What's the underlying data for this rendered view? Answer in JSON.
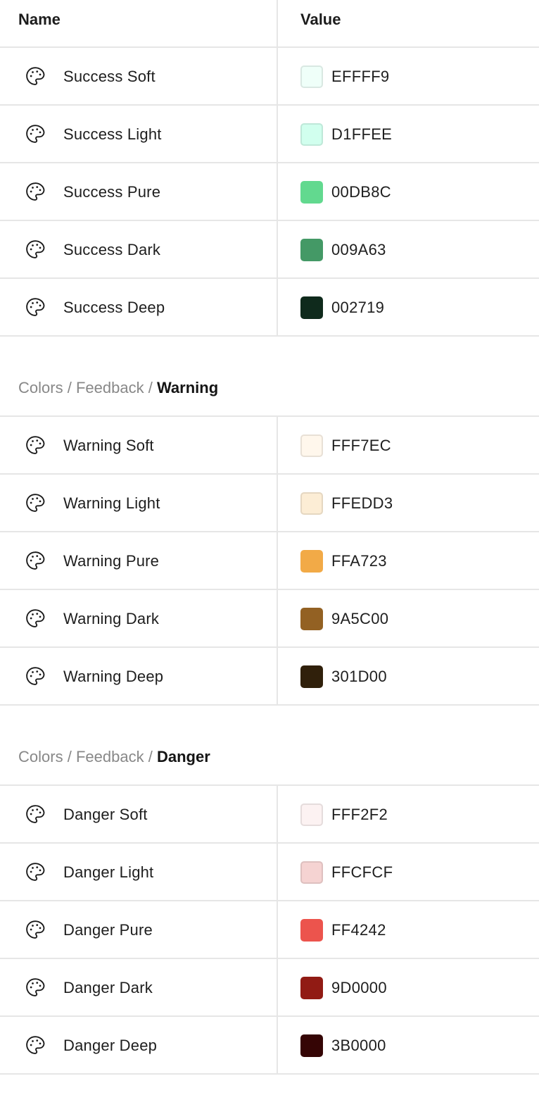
{
  "table": {
    "headers": {
      "name": "Name",
      "value": "Value"
    }
  },
  "groups": [
    {
      "breadcrumb": null,
      "rows": [
        {
          "name": "Success Soft",
          "hex": "EFFFF9",
          "color": "#EFFFF9",
          "icon": "palette-icon"
        },
        {
          "name": "Success Light",
          "hex": "D1FFEE",
          "color": "#D1FFEE",
          "icon": "palette-icon"
        },
        {
          "name": "Success Pure",
          "hex": "00DB8C",
          "color": "#62D98F",
          "icon": "palette-icon"
        },
        {
          "name": "Success Dark",
          "hex": "009A63",
          "color": "#449966",
          "icon": "palette-icon"
        },
        {
          "name": "Success Deep",
          "hex": "002719",
          "color": "#0F2A1C",
          "icon": "palette-icon"
        }
      ]
    },
    {
      "breadcrumb": {
        "root": "Colors",
        "parent": "Feedback",
        "current": "Warning",
        "separator": "/"
      },
      "rows": [
        {
          "name": "Warning Soft",
          "hex": "FFF7EC",
          "color": "#FFF7EC",
          "icon": "palette-icon"
        },
        {
          "name": "Warning Light",
          "hex": "FFEDD3",
          "color": "#FCEDD5",
          "icon": "palette-icon"
        },
        {
          "name": "Warning Pure",
          "hex": "FFA723",
          "color": "#F2AA47",
          "icon": "palette-icon"
        },
        {
          "name": "Warning Dark",
          "hex": "9A5C00",
          "color": "#936123",
          "icon": "palette-icon"
        },
        {
          "name": "Warning Deep",
          "hex": "301D00",
          "color": "#30200B",
          "icon": "palette-icon"
        }
      ]
    },
    {
      "breadcrumb": {
        "root": "Colors",
        "parent": "Feedback",
        "current": "Danger",
        "separator": "/"
      },
      "rows": [
        {
          "name": "Danger Soft",
          "hex": "FFF2F2",
          "color": "#FCF2F2",
          "icon": "palette-icon"
        },
        {
          "name": "Danger Light",
          "hex": "FFCFCF",
          "color": "#F5D3D2",
          "icon": "palette-icon"
        },
        {
          "name": "Danger Pure",
          "hex": "FF4242",
          "color": "#EC544D",
          "icon": "palette-icon"
        },
        {
          "name": "Danger Dark",
          "hex": "9D0000",
          "color": "#911B14",
          "icon": "palette-icon"
        },
        {
          "name": "Danger Deep",
          "hex": "3B0000",
          "color": "#350505",
          "icon": "palette-icon"
        }
      ]
    }
  ]
}
